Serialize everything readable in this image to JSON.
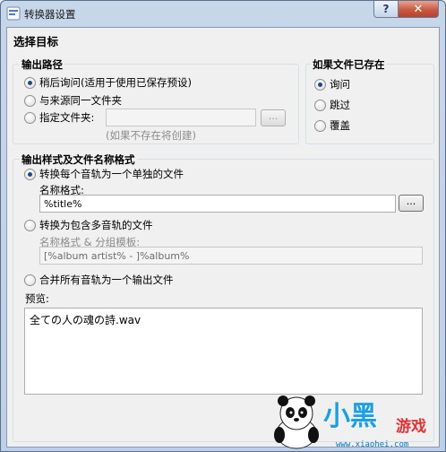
{
  "window": {
    "title": "转换器设置"
  },
  "titlebar": {
    "help_label": "?",
    "close_label": "✕"
  },
  "section_title": "选择目标",
  "output_path": {
    "group_label": "输出路径",
    "options": [
      {
        "label": "稍后询问(适用于使用已保存预设)",
        "checked": true
      },
      {
        "label": "与来源同一文件夹",
        "checked": false
      },
      {
        "label": "指定文件夹:",
        "checked": false
      }
    ],
    "folder_value": "",
    "browse_label": "...",
    "hint": "(如果不存在将创建)"
  },
  "if_exists": {
    "group_label": "如果文件已存在",
    "options": [
      {
        "label": "询问",
        "checked": true
      },
      {
        "label": "跳过",
        "checked": false
      },
      {
        "label": "覆盖",
        "checked": false
      }
    ]
  },
  "output_style": {
    "group_label": "输出样式及文件名称格式",
    "option_single": "转换每个音轨为一个单独的文件",
    "name_format_label": "名称格式:",
    "name_format_value": "%title%",
    "browse_label": "...",
    "option_multi": "转换为包含多音轨的文件",
    "multi_format_label": "名称格式 & 分组模板:",
    "multi_format_value": "[%album artist% - ]%album%",
    "option_merge": "合并所有音轨为一个输出文件",
    "preview_label": "预览:",
    "preview_text": "全ての人の魂の詩.wav"
  },
  "watermark": {
    "text": "小黑",
    "text2": "游戏",
    "url": "www.xiaohei.com"
  },
  "colors": {
    "accent": "#1d4a8c",
    "close": "#c85a43",
    "watermark": "#1aa0e8"
  }
}
